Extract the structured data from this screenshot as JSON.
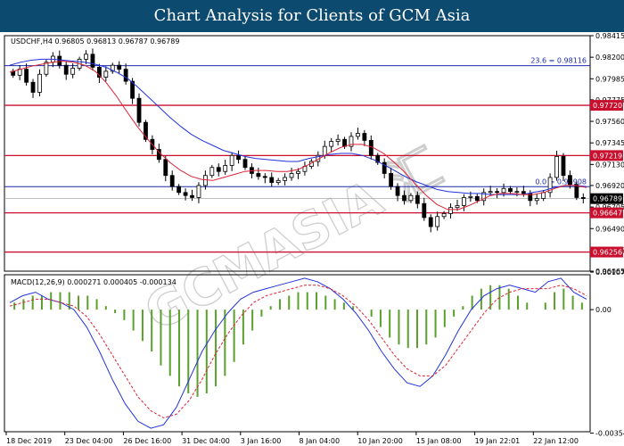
{
  "banner": {
    "title": "Chart Analysis for Clients of GCM Asia"
  },
  "watermark": "GCMASIA 汇",
  "chart_data": [
    {
      "type": "candlestick",
      "header": "USDCHF,H4  0.96805 0.96813 0.96787 0.96789",
      "symbol": "USDCHF",
      "timeframe": "H4",
      "ohlc_last": {
        "open": 0.96805,
        "high": 0.96813,
        "low": 0.96787,
        "close": 0.96789
      },
      "ylim": [
        0.96065,
        0.98415
      ],
      "y_ticks": [
        "0.98415",
        "0.98200",
        "0.97985",
        "0.97775",
        "0.97560",
        "0.97345",
        "0.97130",
        "0.96920",
        "0.96705",
        "0.96490",
        "0.96275",
        "0.96065"
      ],
      "x_ticks": [
        "18 Dec 2019",
        "23 Dec 04:00",
        "26 Dec 16:00",
        "31 Dec 04:00",
        "3 Jan 16:00",
        "8 Jan 04:00",
        "10 Jan 20:00",
        "15 Jan 08:00",
        "19 Jan 22:01",
        "22 Jan 12:00"
      ],
      "current_price": {
        "label": "0.96789",
        "value": 0.96789
      },
      "horizontal_levels": [
        {
          "value": 0.9772,
          "label": "0.97720",
          "color": "#c8102e"
        },
        {
          "value": 0.97219,
          "label": "0.97219",
          "color": "#c8102e"
        },
        {
          "value": 0.96647,
          "label": "0.96647",
          "color": "#c8102e"
        },
        {
          "value": 0.96256,
          "label": "0.96256",
          "color": "#c8102e"
        }
      ],
      "fib_levels": [
        {
          "value": 0.98116,
          "label": "23.6 = 0.98116",
          "color": "#1c2ba8"
        },
        {
          "value": 0.96908,
          "label": "0.0 = 0.96908",
          "color": "#1c2ba8"
        }
      ],
      "close_series": [
        0.9802,
        0.9808,
        0.9795,
        0.9785,
        0.9803,
        0.9815,
        0.9821,
        0.9812,
        0.9803,
        0.9809,
        0.9818,
        0.9823,
        0.981,
        0.98,
        0.9806,
        0.9812,
        0.9808,
        0.9796,
        0.9779,
        0.9755,
        0.9738,
        0.9728,
        0.9718,
        0.9702,
        0.9691,
        0.9685,
        0.9682,
        0.968,
        0.9692,
        0.9702,
        0.971,
        0.9706,
        0.9712,
        0.9722,
        0.9718,
        0.971,
        0.9704,
        0.9701,
        0.97,
        0.9695,
        0.9697,
        0.97,
        0.9704,
        0.9706,
        0.9711,
        0.9716,
        0.9722,
        0.9731,
        0.9736,
        0.9738,
        0.9731,
        0.9741,
        0.9744,
        0.9737,
        0.9722,
        0.9715,
        0.9704,
        0.9691,
        0.9682,
        0.9677,
        0.9682,
        0.9674,
        0.966,
        0.9651,
        0.9661,
        0.9664,
        0.967,
        0.9672,
        0.968,
        0.9681,
        0.9677,
        0.9685,
        0.9686,
        0.9685,
        0.9689,
        0.9686,
        0.9686,
        0.9684,
        0.9677,
        0.9679,
        0.9685,
        0.97,
        0.9721,
        0.9702,
        0.9693,
        0.968,
        0.9679
      ],
      "ma_blue": [
        0.9812,
        0.9815,
        0.9817,
        0.9818,
        0.9818,
        0.9817,
        0.9816,
        0.9815,
        0.9813,
        0.981,
        0.9805,
        0.9799,
        0.979,
        0.978,
        0.977,
        0.976,
        0.9751,
        0.9743,
        0.9737,
        0.9732,
        0.9727,
        0.9724,
        0.9721,
        0.9719,
        0.9718,
        0.9717,
        0.9716,
        0.9716,
        0.9719,
        0.9721,
        0.9723,
        0.9724,
        0.9724,
        0.9722,
        0.9718,
        0.9713,
        0.9707,
        0.9701,
        0.9696,
        0.9692,
        0.9688,
        0.9686,
        0.9685,
        0.9684,
        0.9684,
        0.9683,
        0.9683,
        0.9683,
        0.9683,
        0.9685,
        0.9687,
        0.969,
        0.9692,
        0.9692,
        0.9691
      ],
      "ma_red": [
        0.9805,
        0.9808,
        0.9811,
        0.9813,
        0.9815,
        0.9816,
        0.9815,
        0.9812,
        0.9806,
        0.9795,
        0.9781,
        0.9765,
        0.975,
        0.9737,
        0.9725,
        0.9715,
        0.9707,
        0.9701,
        0.9698,
        0.9697,
        0.97,
        0.9703,
        0.9706,
        0.9707,
        0.9707,
        0.9706,
        0.9706,
        0.9708,
        0.9713,
        0.9719,
        0.9725,
        0.973,
        0.9733,
        0.9733,
        0.973,
        0.9724,
        0.9715,
        0.9705,
        0.9693,
        0.9682,
        0.9673,
        0.9668,
        0.9668,
        0.9672,
        0.9677,
        0.9682,
        0.9684,
        0.9684,
        0.9683,
        0.9683,
        0.9685,
        0.9689,
        0.9692,
        0.9692,
        0.969
      ],
      "sub": {
        "indicator": "MACD(12,26,9)",
        "values_label": "0.000271 0.000405 -0.000134",
        "ylim": [
          -0.0035,
          0.001
        ],
        "y_ticks": [
          "0.001075",
          "0.00",
          "-0.00354"
        ],
        "histogram": [
          0.0002,
          0.0003,
          0.0004,
          0.0004,
          0.0005,
          0.0005,
          0.0005,
          0.0004,
          0.0004,
          0.0003,
          0.0001,
          -0.0001,
          -0.0003,
          -0.0006,
          -0.0009,
          -0.0012,
          -0.0016,
          -0.0019,
          -0.0022,
          -0.0024,
          -0.0025,
          -0.0024,
          -0.0022,
          -0.0019,
          -0.0015,
          -0.001,
          -0.0006,
          -0.0002,
          0.0001,
          0.0003,
          0.0004,
          0.0005,
          0.0005,
          0.0005,
          0.0004,
          0.0003,
          0.0002,
          0.0001,
          0.0,
          -0.0002,
          -0.0005,
          -0.0008,
          -0.001,
          -0.0011,
          -0.0011,
          -0.001,
          -0.0008,
          -0.0005,
          -0.0002,
          0.0001,
          0.0004,
          0.0006,
          0.0007,
          0.0007,
          0.0006,
          0.0004,
          0.0002,
          0.0,
          0.0002,
          0.0005,
          0.0006,
          0.0004,
          0.0002
        ],
        "macd": [
          0.0002,
          0.0004,
          0.0005,
          0.0003,
          0.0002,
          0.0,
          -0.0005,
          -0.0012,
          -0.002,
          -0.0027,
          -0.0032,
          -0.0034,
          -0.0033,
          -0.0028,
          -0.002,
          -0.0012,
          -0.0006,
          -0.0001,
          0.0003,
          0.0005,
          0.0006,
          0.0007,
          0.0008,
          0.0009,
          0.0008,
          0.0006,
          0.0003,
          -0.0001,
          -0.0006,
          -0.0012,
          -0.0017,
          -0.0021,
          -0.0022,
          -0.0019,
          -0.0013,
          -0.0006,
          0.0,
          0.0004,
          0.0006,
          0.0007,
          0.0006,
          0.0005,
          0.0008,
          0.0009,
          0.0005,
          0.0003
        ],
        "signal": [
          0.0001,
          0.0002,
          0.0003,
          0.0003,
          0.0002,
          0.0001,
          -0.0002,
          -0.0007,
          -0.0013,
          -0.0019,
          -0.0025,
          -0.0029,
          -0.0031,
          -0.003,
          -0.0026,
          -0.002,
          -0.0013,
          -0.0007,
          -0.0002,
          0.0002,
          0.0004,
          0.0005,
          0.0006,
          0.0007,
          0.0007,
          0.0006,
          0.0004,
          0.0001,
          -0.0003,
          -0.0008,
          -0.0013,
          -0.0017,
          -0.0019,
          -0.0019,
          -0.0016,
          -0.0011,
          -0.0006,
          -0.0001,
          0.0003,
          0.0005,
          0.0006,
          0.0006,
          0.0006,
          0.0007,
          0.0006,
          0.0004
        ]
      }
    }
  ]
}
